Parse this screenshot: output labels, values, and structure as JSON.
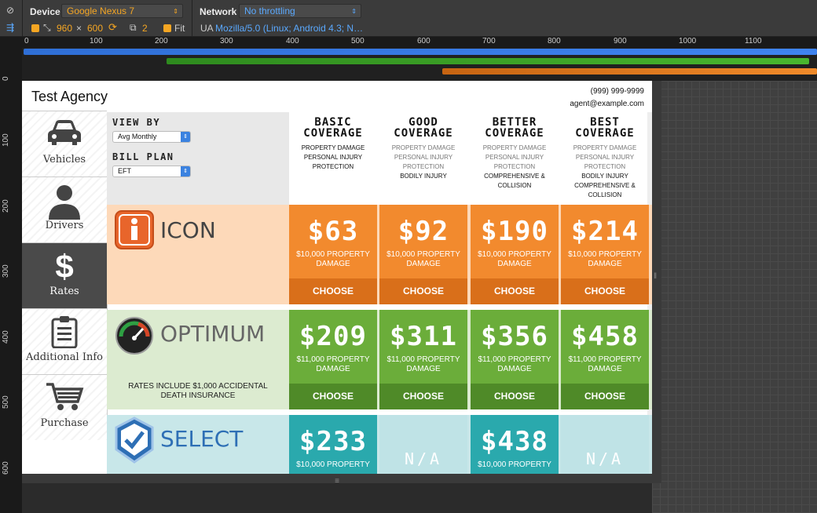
{
  "devtools": {
    "device_label": "Device",
    "device_value": "Google Nexus 7",
    "network_label": "Network",
    "network_value": "No throttling",
    "width": "960",
    "times": "×",
    "height": "600",
    "dpr": "2",
    "fit_label": "Fit",
    "ua_label": "UA",
    "ua_value": "Mozilla/5.0 (Linux; Android 4.3; N…",
    "ruler_top": [
      "0",
      "100",
      "200",
      "300",
      "400",
      "500",
      "600",
      "700",
      "800",
      "900",
      "1000",
      "1100"
    ],
    "ruler_left": [
      "100",
      "200",
      "300",
      "400",
      "500",
      "600"
    ],
    "ruler_zero": "0",
    "colors": {
      "accent": "#f5a623",
      "blue": "#5aa9ff"
    }
  },
  "app": {
    "title": "Test Agency",
    "phone": "(999) 999-9999",
    "email": "agent@example.com"
  },
  "sidebar": {
    "items": [
      {
        "label": "Vehicles",
        "icon": "car-icon"
      },
      {
        "label": "Drivers",
        "icon": "person-icon"
      },
      {
        "label": "Rates",
        "icon": "dollar-icon"
      },
      {
        "label": "Additional Info",
        "icon": "clipboard-icon"
      },
      {
        "label": "Purchase",
        "icon": "cart-icon"
      }
    ],
    "active": "Rates"
  },
  "options": {
    "view_by_label": "VIEW BY",
    "view_by_value": "Avg Monthly",
    "bill_plan_label": "BILL PLAN",
    "bill_plan_value": "EFT"
  },
  "coverages": [
    {
      "title": "BASIC\nCOVERAGE",
      "lines": [
        {
          "t": "PROPERTY DAMAGE",
          "dim": false
        },
        {
          "t": "PERSONAL INJURY",
          "dim": false
        },
        {
          "t": "PROTECTION",
          "dim": false
        }
      ]
    },
    {
      "title": "GOOD\nCOVERAGE",
      "lines": [
        {
          "t": "PROPERTY DAMAGE",
          "dim": true
        },
        {
          "t": "PERSONAL INJURY",
          "dim": true
        },
        {
          "t": "PROTECTION",
          "dim": true
        },
        {
          "t": "BODILY INJURY",
          "dim": false
        }
      ]
    },
    {
      "title": "BETTER\nCOVERAGE",
      "lines": [
        {
          "t": "PROPERTY DAMAGE",
          "dim": true
        },
        {
          "t": "PERSONAL INJURY",
          "dim": true
        },
        {
          "t": "PROTECTION",
          "dim": true
        },
        {
          "t": "COMPREHENSIVE &",
          "dim": false
        },
        {
          "t": "COLLISION",
          "dim": false
        }
      ]
    },
    {
      "title": "BEST\nCOVERAGE",
      "lines": [
        {
          "t": "PROPERTY DAMAGE",
          "dim": true
        },
        {
          "t": "PERSONAL INJURY",
          "dim": true
        },
        {
          "t": "PROTECTION",
          "dim": true
        },
        {
          "t": "BODILY INJURY",
          "dim": false
        },
        {
          "t": "COMPREHENSIVE &",
          "dim": false
        },
        {
          "t": "COLLISION",
          "dim": false
        }
      ]
    }
  ],
  "plans": [
    {
      "name": "ICON",
      "note": "",
      "bg": "#fdd9b9",
      "cell": "#f28a2e",
      "choose_bg": "#d96f1a",
      "na_bg": "",
      "prices": [
        {
          "price": "$63",
          "desc": "$10,000 PROPERTY DAMAGE",
          "choose": "CHOOSE"
        },
        {
          "price": "$92",
          "desc": "$10,000 PROPERTY DAMAGE",
          "choose": "CHOOSE"
        },
        {
          "price": "$190",
          "desc": "$10,000 PROPERTY DAMAGE",
          "choose": "CHOOSE"
        },
        {
          "price": "$214",
          "desc": "$10,000 PROPERTY DAMAGE",
          "choose": "CHOOSE"
        }
      ]
    },
    {
      "name": "OPTIMUM",
      "note": "RATES INCLUDE $1,000 ACCIDENTAL DEATH INSURANCE",
      "bg": "#dcebd0",
      "cell": "#6bad3a",
      "choose_bg": "#4f8a28",
      "na_bg": "",
      "prices": [
        {
          "price": "$209",
          "desc": "$11,000 PROPERTY DAMAGE",
          "choose": "CHOOSE"
        },
        {
          "price": "$311",
          "desc": "$11,000 PROPERTY DAMAGE",
          "choose": "CHOOSE"
        },
        {
          "price": "$356",
          "desc": "$11,000 PROPERTY DAMAGE",
          "choose": "CHOOSE"
        },
        {
          "price": "$458",
          "desc": "$11,000 PROPERTY DAMAGE",
          "choose": "CHOOSE"
        }
      ]
    },
    {
      "name": "SELECT",
      "note": "",
      "bg": "#c8e7e9",
      "cell": "#2aa9ad",
      "choose_bg": "#1f8c90",
      "na_bg": "#bfe3e6",
      "prices": [
        {
          "price": "$233",
          "desc": "$10,000 PROPERTY",
          "choose": ""
        },
        {
          "price": "N/A",
          "desc": "",
          "choose": ""
        },
        {
          "price": "$438",
          "desc": "$10,000 PROPERTY",
          "choose": ""
        },
        {
          "price": "N/A",
          "desc": "",
          "choose": ""
        }
      ]
    }
  ]
}
